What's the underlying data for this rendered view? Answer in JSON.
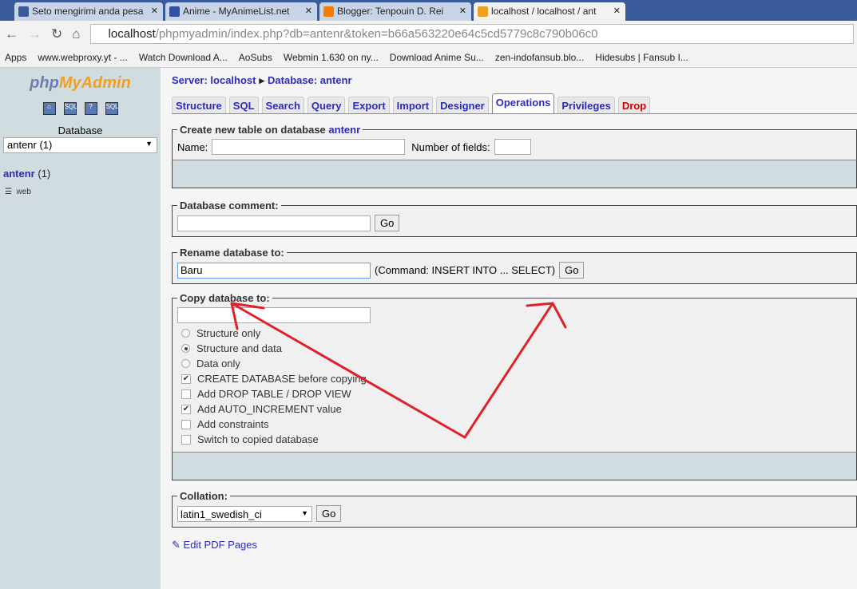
{
  "browser": {
    "tabs": [
      {
        "title": "Seto mengirimi anda pesa",
        "icon": "facebook-icon"
      },
      {
        "title": "Anime - MyAnimeList.net",
        "icon": "mal-icon"
      },
      {
        "title": "Blogger: Tenpouin D. Rei",
        "icon": "blogger-icon"
      },
      {
        "title": "localhost / localhost / ant",
        "icon": "pma-icon",
        "active": true
      }
    ],
    "url_host": "localhost",
    "url_path": "/phpmyadmin/index.php?db=antenr&token=b66a563220e64c5cd5779c8c790b06c0",
    "bookmarks": [
      "Apps",
      "www.webproxy.yt - ...",
      "Watch Download A...",
      "AoSubs",
      "Webmin 1.630 on ny...",
      "Download Anime Su...",
      "zen-indofansub.blo...",
      "Hidesubs | Fansub I..."
    ]
  },
  "sidebar": {
    "logo": "phpMyAdmin",
    "db_label": "Database",
    "db_select": "antenr (1)",
    "db_name": "antenr",
    "db_count": "(1)",
    "tables": [
      "web"
    ]
  },
  "breadcrumb": {
    "server": "Server: localhost",
    "database": "Database: antenr"
  },
  "tabs": [
    "Structure",
    "SQL",
    "Search",
    "Query",
    "Export",
    "Import",
    "Designer",
    "Operations",
    "Privileges",
    "Drop"
  ],
  "active_tab": "Operations",
  "create": {
    "legend": "Create new table on database ",
    "db": "antenr",
    "name_label": "Name:",
    "name_value": "",
    "fields_label": "Number of fields:",
    "fields_value": ""
  },
  "comment": {
    "legend": "Database comment:",
    "value": "",
    "go": "Go"
  },
  "rename": {
    "legend": "Rename database to:",
    "value": "Baru",
    "note": "(Command: INSERT INTO ... SELECT)",
    "go": "Go"
  },
  "copy": {
    "legend": "Copy database to:",
    "value": "",
    "radios": [
      {
        "label": "Structure only",
        "checked": false
      },
      {
        "label": "Structure and data",
        "checked": true
      },
      {
        "label": "Data only",
        "checked": false
      }
    ],
    "checks": [
      {
        "label": "CREATE DATABASE before copying",
        "checked": true
      },
      {
        "label": "Add DROP TABLE / DROP VIEW",
        "checked": false
      },
      {
        "label": "Add AUTO_INCREMENT value",
        "checked": true
      },
      {
        "label": "Add constraints",
        "checked": false
      },
      {
        "label": "Switch to copied database",
        "checked": false
      }
    ]
  },
  "collation": {
    "legend": "Collation:",
    "value": "latin1_swedish_ci",
    "go": "Go"
  },
  "edit_pdf": "Edit PDF Pages",
  "annotation_color": "#e0202a"
}
